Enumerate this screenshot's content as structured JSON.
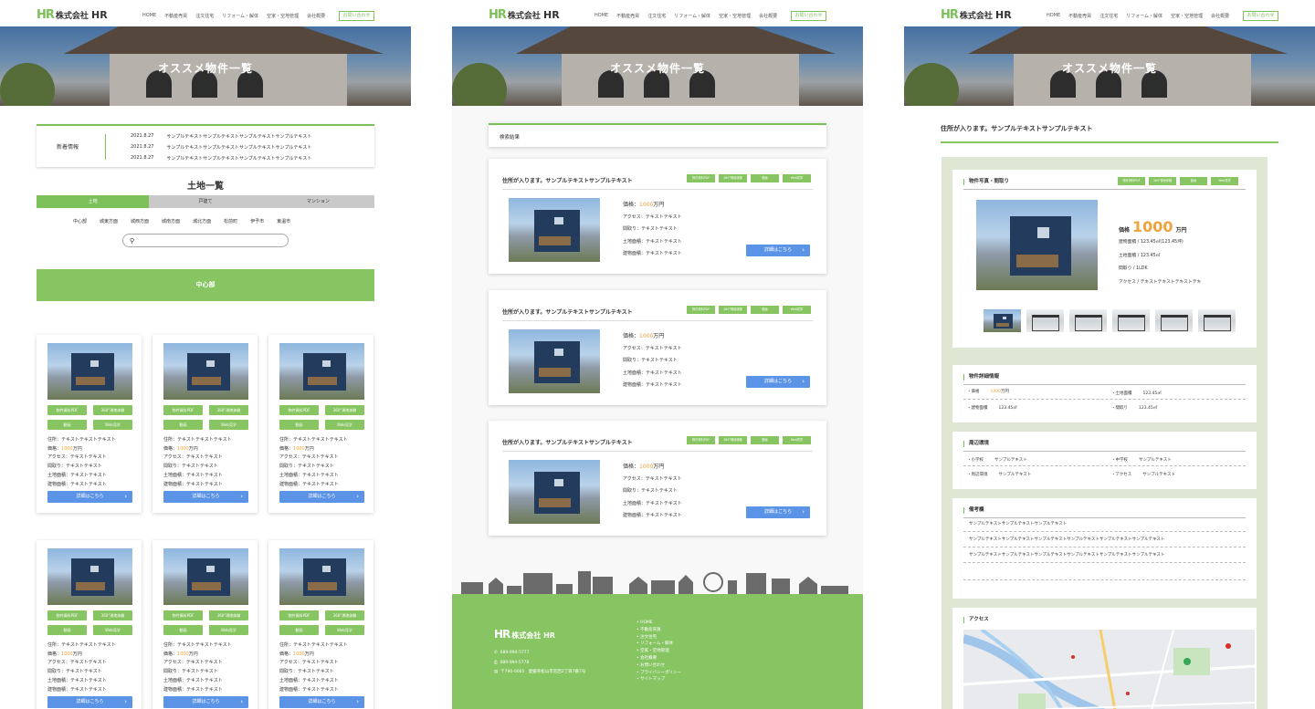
{
  "site": {
    "logo_mark": "HR",
    "company_prefix": "株式会社",
    "company_name": "HR",
    "nav": [
      "HOME",
      "不動産売買",
      "注文住宅",
      "リフォーム・解体",
      "空家・空地管理",
      "会社概要"
    ],
    "contact_label": "お問い合わせ",
    "hero_title": "オススメ物件一覧"
  },
  "panel1": {
    "news": {
      "label": "新着情報",
      "items": [
        {
          "date": "2021.8.27",
          "text": "サンプルテキストサンプルテキストサンプルテキストサンプルテキスト"
        },
        {
          "date": "2021.8.27",
          "text": "サンプルテキストサンプルテキストサンプルテキストサンプルテキスト"
        },
        {
          "date": "2021.8.27",
          "text": "サンプルテキストサンプルテキストサンプルテキストサンプルテキスト"
        }
      ]
    },
    "section_title": "土地一覧",
    "tabs": [
      "土地",
      "戸建て",
      "マンション"
    ],
    "areas": [
      "中心部",
      "城東方面",
      "城西方面",
      "城南方面",
      "城北方面",
      "松前町",
      "伊予市",
      "東温市"
    ],
    "search_placeholder": "",
    "banner": "中心部",
    "card": {
      "btn_pdf": "物件資料PDF",
      "btn_360": "360°現地体験",
      "btn_video": "動画",
      "btn_web": "Web見学",
      "addr_label": "住所：",
      "addr_value": "テキストテキストテキスト",
      "price_label": "価格：",
      "price_value": "1000",
      "price_unit": "万円",
      "access": "アクセス：テキストテキスト",
      "madori": "間取り：テキストテキスト",
      "land": "土地面積：テキストテキスト",
      "building": "建物面積：テキストテキスト",
      "detail": "詳細はこちら"
    }
  },
  "panel2": {
    "result_label": "検索結果",
    "listing": {
      "title": "住所が入ります。サンプルテキストサンプルテキスト",
      "tags": [
        "物件資料PDF",
        "360°現地体験",
        "動画",
        "Web見学"
      ],
      "price_label": "価格：",
      "price_value": "1000",
      "price_unit": "万円",
      "access": "アクセス：テキストテキスト",
      "madori": "間取り：テキストテキスト",
      "land": "土地面積：テキストテキスト",
      "building": "建物面積：テキストテキスト",
      "detail": "詳細はこちら"
    },
    "footer": {
      "tel": "089-994-5777",
      "fax": "089-994-5778",
      "address": "〒790-0065　愛媛県松山市宮西2丁目7番7号",
      "links": [
        "HOME",
        "不動産売買",
        "注文住宅",
        "リフォーム・解体",
        "空家・空地管理",
        "会社概要",
        "お問い合わせ",
        "プライバシーポリシー",
        "サイトマップ"
      ]
    }
  },
  "panel3": {
    "heading": "住所が入ります。サンプルテキストサンプルテキスト",
    "photo_box_title": "物件写真・間取り",
    "tags": [
      "物件資料PDF",
      "360°現地体験",
      "動画",
      "Web見学"
    ],
    "price_label": "価格",
    "price_value": "1000",
    "price_unit": "万円",
    "building_area": "建物面積 / 123.45㎡(123.45坪)",
    "land_area": "土地面積 / 123.45㎡",
    "madori": "間取り / 1LDK",
    "access": "アクセス / テキストテキストテキストテキ",
    "detail_title": "物件詳細情報",
    "detail": {
      "price_key": "・価格",
      "price_val": "1000",
      "price_unit": "万円",
      "land_key": "・土地面積",
      "land_val": "123.45㎡",
      "bld_key": "・建物面積",
      "bld_val": "123.45㎡",
      "madori_key": "・間取り",
      "madori_val": "123.45㎡"
    },
    "env_title": "周辺環境",
    "env": {
      "elem_key": "・小学校",
      "elem_val": "サンプルテキスト",
      "jh_key": "・中学校",
      "jh_val": "サンプルテキスト",
      "around_key": "・周辺環境",
      "around_val": "サンプルテキスト",
      "access_key": "・アクセス",
      "access_val": "サンプルテキスト"
    },
    "remarks_title": "備考欄",
    "remarks": [
      "サンプルテキストサンプルテキストサンプルテキスト",
      "サンプルテキストサンプルテキストサンプルテキストサンプルテキストサンプルテキストサンプルテキスト",
      "サンプルテキストサンプルテキストサンプルテキストサンプルテキストサンプルテキストサンプルテキスト"
    ],
    "access_title": "アクセス"
  },
  "colors": {
    "accent": "#86c562",
    "price": "#f0a33a",
    "detail_button": "#5b94e6"
  }
}
